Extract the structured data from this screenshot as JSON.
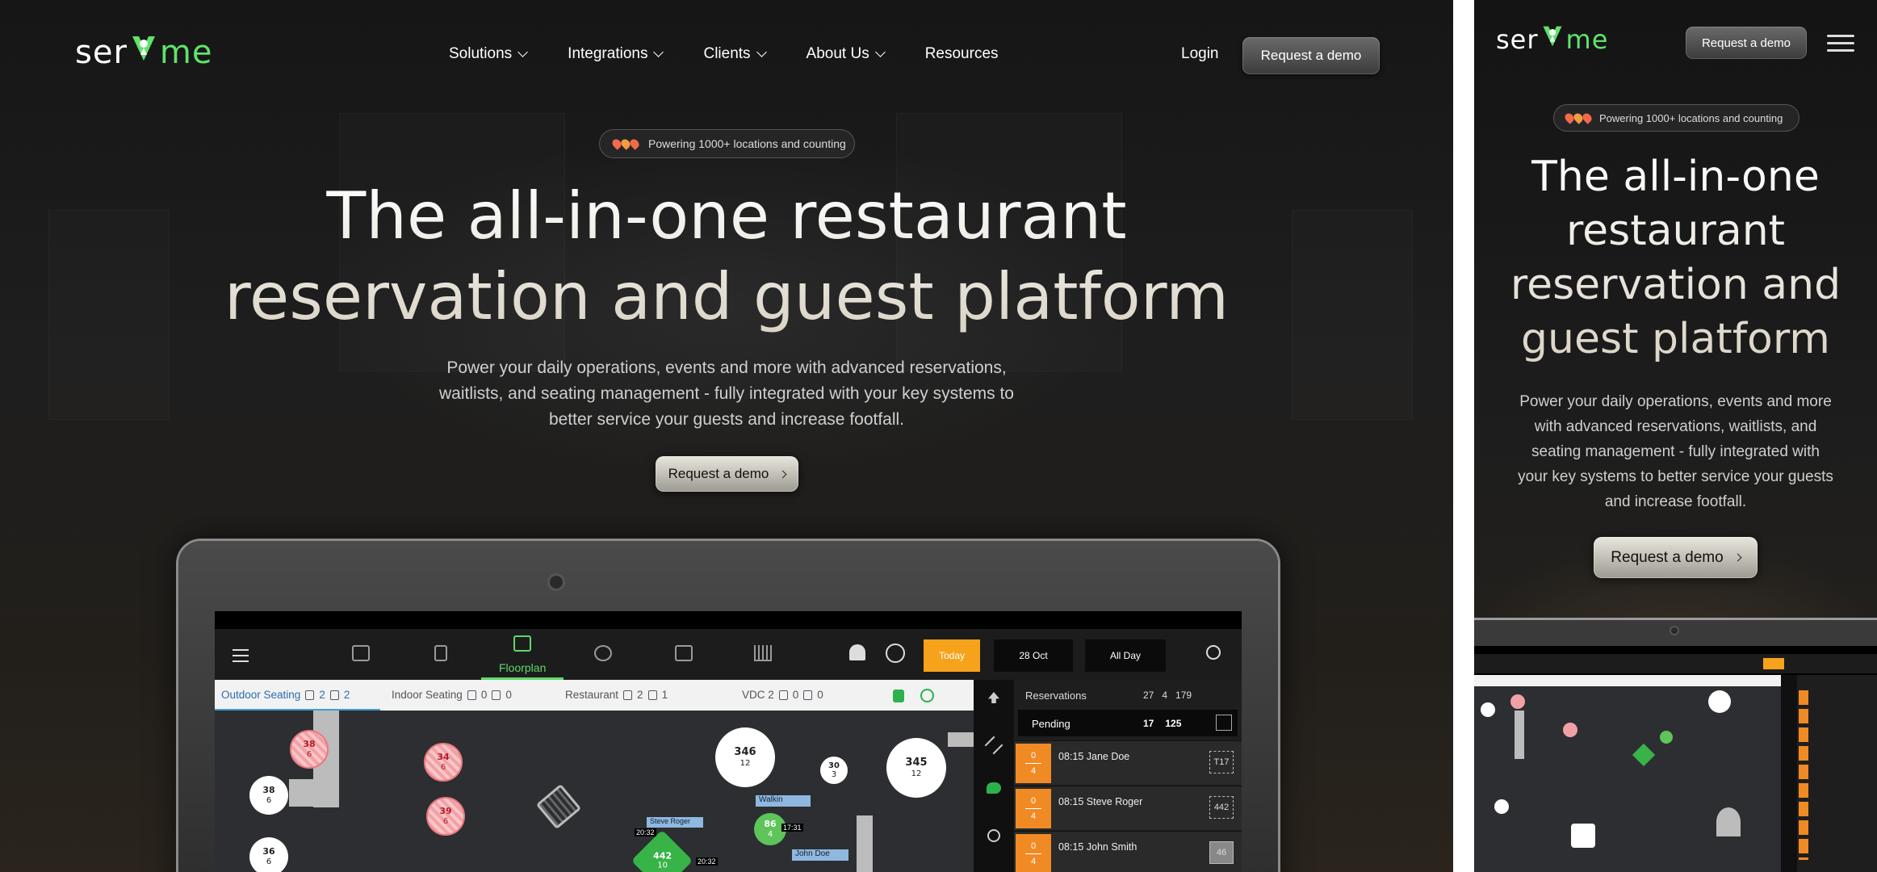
{
  "brand": {
    "prefix": "ser",
    "suffix": "me"
  },
  "nav": {
    "items": [
      "Solutions",
      "Integrations",
      "Clients",
      "About Us",
      "Resources"
    ],
    "login": "Login",
    "cta": "Request a demo"
  },
  "hero": {
    "badge": "Powering 1000+ locations and counting",
    "title_line1": "The all-in-one restaurant",
    "title_line2": "reservation and guest platform",
    "subtitle_line1": "Power your daily operations, events and more with advanced reservations,",
    "subtitle_line2": "waitlists, and seating management - fully integrated with your key systems to",
    "subtitle_line3": "better service your guests and increase footfall.",
    "cta": "Request a demo"
  },
  "app": {
    "active_tab": "Floorplan",
    "today": "Today",
    "date": "28 Oct",
    "period": "All Day",
    "zones": [
      {
        "name": "Outdoor Seating",
        "a": "2",
        "b": "2"
      },
      {
        "name": "Indoor Seating",
        "a": "0",
        "b": "0"
      },
      {
        "name": "Restaurant",
        "a": "2",
        "b": "1"
      },
      {
        "name": "VDC 2",
        "a": "0",
        "b": "0"
      }
    ],
    "reservations": {
      "title": "Reservations",
      "c1": "27",
      "c2": "4",
      "c3": "179",
      "pending_label": "Pending",
      "p1": "17",
      "p2": "125"
    },
    "rows": [
      {
        "top": "0",
        "bottom": "4",
        "time_name": "08:15  Jane Doe",
        "tag": "T17"
      },
      {
        "top": "0",
        "bottom": "4",
        "time_name": "08:15  Steve Roger",
        "tag": "442"
      },
      {
        "top": "0",
        "bottom": "4",
        "time_name": "08:15  John Smith",
        "tag": "46"
      }
    ],
    "tables": [
      {
        "id": "38",
        "seats": "6"
      },
      {
        "id": "38",
        "seats": "6"
      },
      {
        "id": "36",
        "seats": "6"
      },
      {
        "id": "34",
        "seats": "6"
      },
      {
        "id": "39",
        "seats": "6"
      },
      {
        "id": "346",
        "seats": "12"
      },
      {
        "id": "30",
        "seats": "3"
      },
      {
        "id": "345",
        "seats": "12"
      },
      {
        "id": "86",
        "seats": "4"
      },
      {
        "id": "442",
        "seats": "10"
      }
    ],
    "labels": {
      "walkin": "Walkin",
      "steve": "Steve Roger",
      "john": "John Doe",
      "t1": "20:32",
      "t2": "20:32",
      "t3": "17:31"
    }
  },
  "mobile": {
    "cta_top": "Request a demo",
    "badge": "Powering 1000+ locations and counting",
    "title_lines": [
      "The all-in-one",
      "restaurant",
      "reservation and",
      "guest platform"
    ],
    "subtitle_lines": [
      "Power your daily operations, events and more",
      "with advanced reservations, waitlists, and",
      "seating management - fully integrated with",
      "your key systems to better service your guests",
      "and increase footfall."
    ],
    "cta": "Request a demo"
  },
  "colors": {
    "brand_green": "#5fe36a",
    "accent_orange": "#f7a21b",
    "dark_bg": "#1a1a1a"
  }
}
